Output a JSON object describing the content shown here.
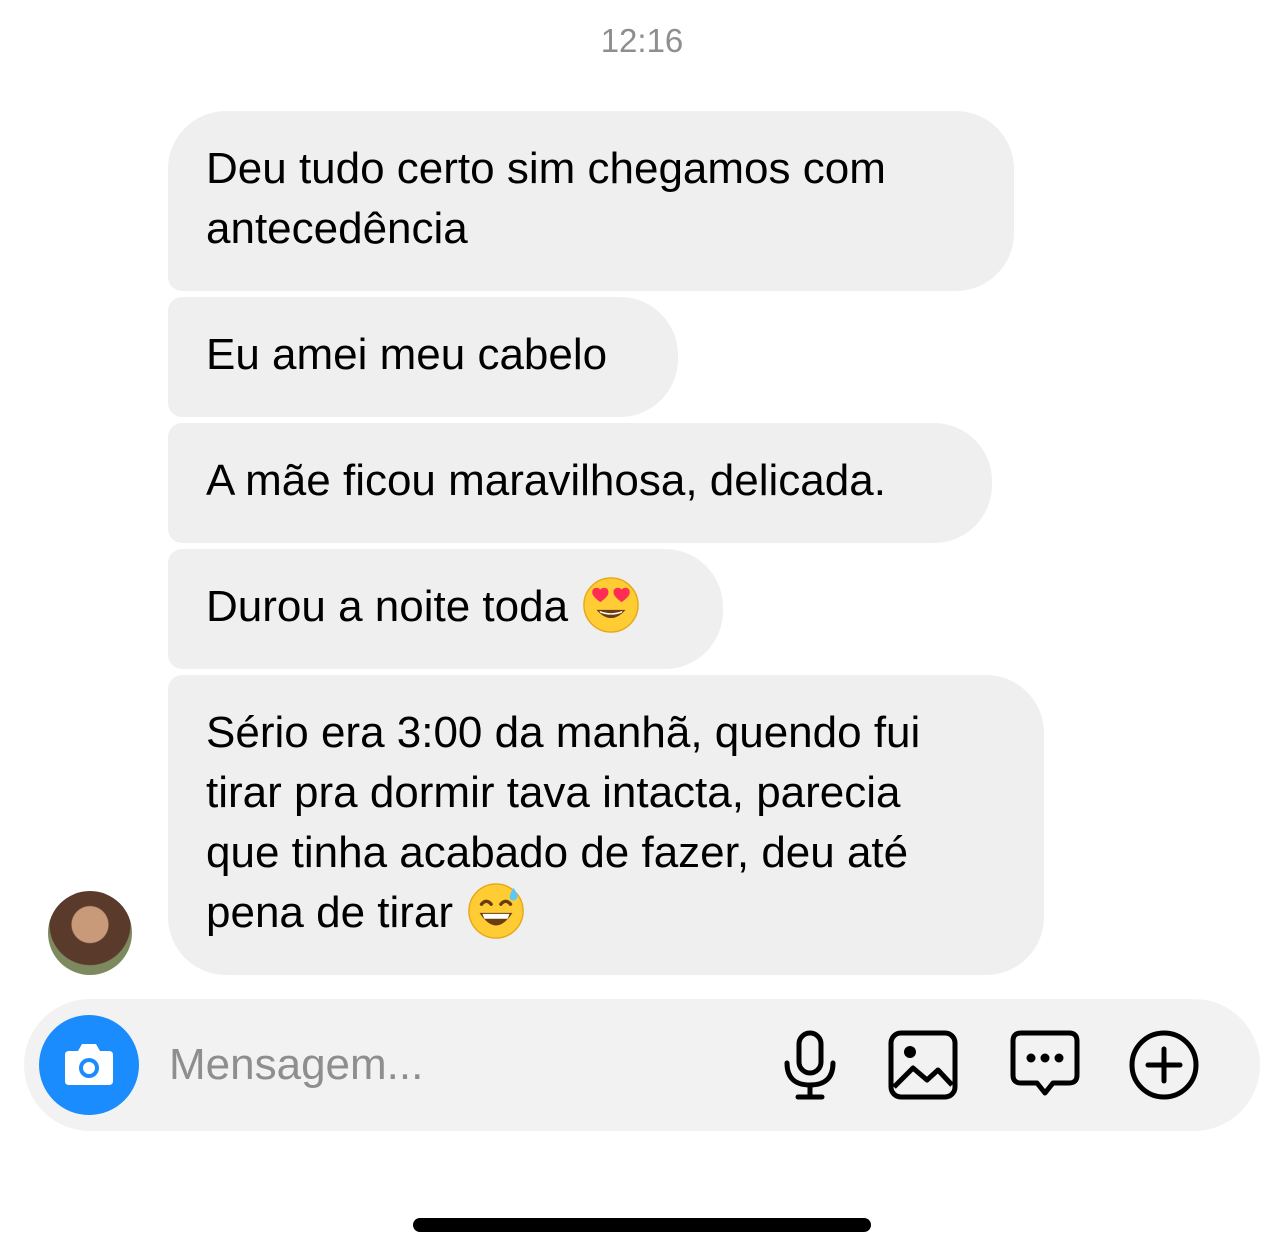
{
  "thread": {
    "timestamp": "12:16",
    "messages": [
      {
        "lines": [
          "Deu tudo certo sim chegamos com",
          "antecedência"
        ]
      },
      {
        "lines": [
          "Eu amei meu cabelo"
        ]
      },
      {
        "lines": [
          "A mãe ficou maravilhosa, delicada."
        ]
      },
      {
        "lines": [
          "Durou a noite toda"
        ],
        "emoji": "heart-eyes-emoji"
      },
      {
        "lines": [
          "Sério era 3:00 da manhã, quendo fui",
          "tirar pra dormir tava intacta, parecia",
          "que tinha acabado de fazer, deu até",
          "pena de tirar"
        ],
        "emoji": "grinning-sweat-emoji"
      }
    ]
  },
  "composer": {
    "placeholder": "Mensagem...",
    "icons": [
      "camera-icon",
      "microphone-icon",
      "gallery-icon",
      "sticker-chat-icon",
      "plus-circle-icon"
    ],
    "camera_color": "#1a8cfe"
  },
  "colors": {
    "bubble_background": "#efefef",
    "timestamp_text": "#8e8e8e",
    "composer_background": "#f2f2f2"
  }
}
